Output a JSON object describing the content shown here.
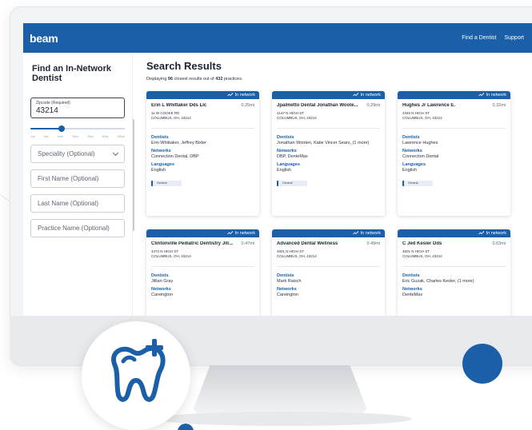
{
  "colors": {
    "brand_blue": "#1a5fa8",
    "text_dark": "#1d2433"
  },
  "header": {
    "logo": "beam",
    "nav": [
      "Find a Dentist",
      "Support"
    ]
  },
  "sidebar": {
    "title": "Find an In-Network Dentist",
    "zipcode_label": "Zipcode (Required)",
    "zipcode_value": "43214",
    "distance_ticks": [
      "1mi",
      "5mi",
      "10mi",
      "15mi",
      "25mi",
      "50mi",
      "100mi"
    ],
    "distance_selected_index": 2,
    "specialty_placeholder": "Speciality (Optional)",
    "first_name_placeholder": "First Name (Optional)",
    "last_name_placeholder": "Last Name (Optional)",
    "practice_name_placeholder": "Practice Name (Optional)"
  },
  "results": {
    "title": "Search Results",
    "sub_prefix": "Displaying ",
    "shown": "96",
    "sub_middle": " closest results out of ",
    "total": "432",
    "sub_suffix": " practices.",
    "network_label": "In network",
    "dentists_label": "Dentists",
    "networks_label": "Networks",
    "languages_label": "Languages",
    "cards": [
      {
        "name": "Erin L Whittaker Dds Llc",
        "distance": "0.25mi",
        "address1": "11 W COOKE RD",
        "address2": "COLUMBUS, OH, 43214",
        "dentists": "Erin Whittaker, Jeffrey Bixler",
        "networks": "Connection Dental, DBP",
        "languages": "English",
        "tag": "General"
      },
      {
        "name": "Jpalmetto Dental Jonathan Woote...",
        "distance": "0.29mi",
        "address1": "4147 N HIGH ST",
        "address2": "COLUMBUS, OH, 43214",
        "dentists": "Jonathan Wooten, Katie Vincer Sears, (1 more)",
        "networks": "DBP, DenteMax",
        "languages": "English",
        "tag": "General"
      },
      {
        "name": "Hughes Jr Lawrence E.",
        "distance": "0.32mi",
        "address1": "4345 N HIGH ST",
        "address2": "COLUMBUS, OH, 43214",
        "dentists": "Lawrence Hughes",
        "networks": "Connection Dental",
        "languages": "English",
        "tag": "General"
      },
      {
        "name": "Clintonville Pediatric Dentistry Jill...",
        "distance": "0.47mi",
        "address1": "4472 N HIGH ST",
        "address2": "COLUMBUS, OH, 43214",
        "dentists": "Jillian Gray",
        "networks": "Careington",
        "languages": "",
        "tag": ""
      },
      {
        "name": "Advanced Dental Wellness",
        "distance": "0.49mi",
        "address1": "4501 N HIGH ST",
        "address2": "COLUMBUS, OH, 43214",
        "dentists": "Mark Raisch",
        "networks": "Careington",
        "languages": "",
        "tag": ""
      },
      {
        "name": "C Jed Kesler Dds",
        "distance": "0.63mi",
        "address1": "4601 N HIGH ST",
        "address2": "COLUMBUS, OH, 43214",
        "dentists": "Eric Guzak, Charles Kesler, (1 more)",
        "networks": "DenteMax",
        "languages": "",
        "tag": ""
      }
    ]
  },
  "badge": {
    "icon": "tooth-plus-icon"
  }
}
